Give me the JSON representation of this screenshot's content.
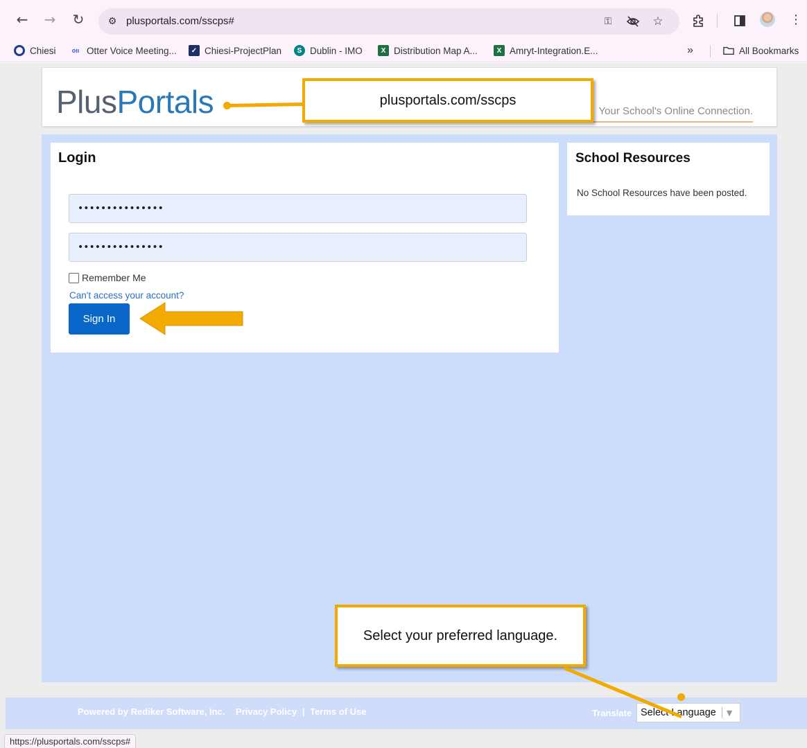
{
  "browser": {
    "url": "plusportals.com/sscps#",
    "status_url": "https://plusportals.com/sscps#",
    "icons": [
      "back-icon",
      "forward-icon",
      "reload-icon",
      "site-settings-icon",
      "password-key-icon",
      "eye-off-icon",
      "star-icon",
      "extensions-icon",
      "side-panel-icon",
      "profile-avatar",
      "more-menu-icon"
    ]
  },
  "bookmarks": {
    "items": [
      {
        "label": "Chiesi",
        "icon": "circle-icon"
      },
      {
        "label": "Otter Voice Meeting...",
        "icon": "otter-icon"
      },
      {
        "label": "Chiesi-ProjectPlan",
        "icon": "check-icon"
      },
      {
        "label": "Dublin - IMO",
        "icon": "sharepoint-icon"
      },
      {
        "label": "Distribution Map A...",
        "icon": "excel-icon"
      },
      {
        "label": "Amryt-Integration.E...",
        "icon": "excel-icon"
      }
    ],
    "overflow": "»",
    "all_bookmarks": "All Bookmarks"
  },
  "header": {
    "logo_plus": "Plus",
    "logo_portals": "Portals",
    "tagline": "Your School's Online Connection."
  },
  "login": {
    "title": "Login",
    "username_value": "•••••••••••••••",
    "password_value": "•••••••••••••••",
    "remember_label": "Remember Me",
    "forgot_link": "Can't access your account?",
    "signin_label": "Sign In"
  },
  "resources": {
    "title": "School Resources",
    "empty_text": "No School Resources have been posted."
  },
  "footer": {
    "powered_by": "Powered by Rediker Software, Inc.",
    "privacy": "Privacy Policy",
    "separator": "|",
    "terms": "Terms of Use",
    "translate_label": "Translate",
    "language_select": "Select Language"
  },
  "annotations": {
    "url_callout": "plusportals.com/sscps",
    "language_callout": "Select your preferred language.",
    "accent_color": "#f2a900"
  }
}
